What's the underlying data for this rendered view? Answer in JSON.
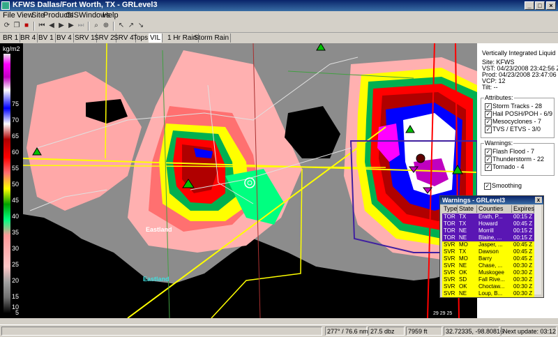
{
  "window": {
    "title": "KFWS Dallas/Fort Worth, TX - GRLevel3"
  },
  "menu": [
    "File",
    "View",
    "Site",
    "Products",
    "GIS",
    "Windows",
    "Help"
  ],
  "products": [
    "BR 1",
    "BR 4",
    "BV 1",
    "BV 4",
    "SRV 1",
    "SRV 2",
    "SRV 4",
    "Tops",
    "VIL",
    "1 Hr Rain",
    "Storm Rain"
  ],
  "active_product": "VIL",
  "legend": {
    "unit": "kg/m2",
    "values": [
      "75",
      "70",
      "65",
      "60",
      "55",
      "50",
      "45",
      "40",
      "35",
      "30",
      "25",
      "20",
      "15",
      "10",
      "5",
      "0"
    ]
  },
  "map": {
    "towns": [
      "Eastland",
      "Eastland"
    ],
    "scale_marks": "29  29  25"
  },
  "info": {
    "title": "Vertically Integrated Liquid",
    "site": "Site: KFWS",
    "vst": "VST: 04/23/2008 23:42:56 Z",
    "prod": "Prod: 04/23/2008 23:47:06 Z",
    "vcp": "VCP: 12",
    "tilt": "Tilt: --"
  },
  "attributes": {
    "title": "Attributes:",
    "items": [
      "Storm Tracks - 28",
      "Hail POSH/POH - 6/9",
      "Mesocyclones - 7",
      "TVS / ETVS - 3/0"
    ]
  },
  "warnings_panel": {
    "title": "Warnings:",
    "items": [
      "Flash Flood - 7",
      "Thunderstorm - 22",
      "Tornado - 4"
    ]
  },
  "smoothing": {
    "label": "Smoothing"
  },
  "warnings_window": {
    "title": "Warnings - GRLevel3",
    "close": "x",
    "headers": [
      "Type",
      "State",
      "Counties",
      "Expires"
    ],
    "rows": [
      {
        "type": "TOR",
        "state": "TX",
        "county": "Erath, P...",
        "expires": "00:15 Z",
        "kind": "tor"
      },
      {
        "type": "TOR",
        "state": "TX",
        "county": "Howard",
        "expires": "00:45 Z",
        "kind": "tor"
      },
      {
        "type": "TOR",
        "state": "NE",
        "county": "Morrill",
        "expires": "00:15 Z",
        "kind": "tor"
      },
      {
        "type": "TOR",
        "state": "NE",
        "county": "Blaine, ...",
        "expires": "00:15 Z",
        "kind": "tor"
      },
      {
        "type": "SVR",
        "state": "MO",
        "county": "Jasper, ...",
        "expires": "00:45 Z",
        "kind": "svr"
      },
      {
        "type": "SVR",
        "state": "TX",
        "county": "Dawson",
        "expires": "00:45 Z",
        "kind": "svr"
      },
      {
        "type": "SVR",
        "state": "MO",
        "county": "Barry",
        "expires": "00:45 Z",
        "kind": "svr"
      },
      {
        "type": "SVR",
        "state": "NE",
        "county": "Chase, ...",
        "expires": "00:30 Z",
        "kind": "svr"
      },
      {
        "type": "SVR",
        "state": "OK",
        "county": "Muskogee",
        "expires": "00:30 Z",
        "kind": "svr"
      },
      {
        "type": "SVR",
        "state": "SD",
        "county": "Fall Rive...",
        "expires": "00:30 Z",
        "kind": "svr"
      },
      {
        "type": "SVR",
        "state": "OK",
        "county": "Choctaw...",
        "expires": "00:30 Z",
        "kind": "svr"
      },
      {
        "type": "SVR",
        "state": "NE",
        "county": "Loup, B...",
        "expires": "00:30 Z",
        "kind": "svr"
      }
    ]
  },
  "status": {
    "bearing": "277° / 76.6 nm",
    "value": "27.5 dbz",
    "height": "7959 ft",
    "latlon": "32.72335, -98.80816",
    "update": "Next update: 03:12"
  },
  "colors": {
    "tor": "#5a16b4",
    "svr": "#ffff00",
    "title_bar": "#0a246a"
  }
}
